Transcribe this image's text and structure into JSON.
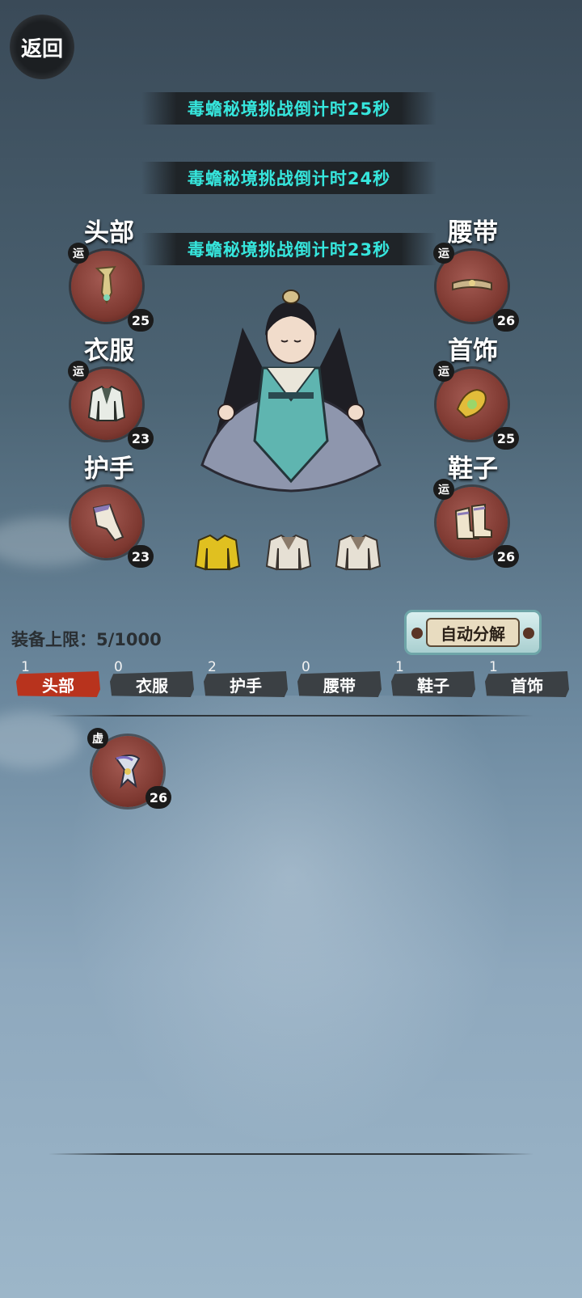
{
  "header": {
    "back_label": "返回"
  },
  "banners": [
    "毒蟾秘境挑战倒计时25秒",
    "毒蟾秘境挑战倒计时24秒",
    "毒蟾秘境挑战倒计时23秒"
  ],
  "slots": {
    "head": {
      "title": "头部",
      "badge": "运",
      "level": "25"
    },
    "clothes": {
      "title": "衣服",
      "badge": "运",
      "level": "23"
    },
    "hands": {
      "title": "护手",
      "badge": "",
      "level": "23"
    },
    "belt": {
      "title": "腰带",
      "badge": "运",
      "level": "26"
    },
    "accessory": {
      "title": "首饰",
      "badge": "运",
      "level": "25"
    },
    "shoes": {
      "title": "鞋子",
      "badge": "运",
      "level": "26"
    }
  },
  "inventory": {
    "capacity_label": "装备上限：5/1000",
    "auto_decompose_label": "自动分解",
    "tabs": [
      {
        "label": "头部",
        "count": "1",
        "active": true
      },
      {
        "label": "衣服",
        "count": "0"
      },
      {
        "label": "护手",
        "count": "2"
      },
      {
        "label": "腰带",
        "count": "0"
      },
      {
        "label": "鞋子",
        "count": "1"
      },
      {
        "label": "首饰",
        "count": "1"
      }
    ],
    "items": [
      {
        "badge": "虚",
        "level": "26",
        "icon": "headpiece-icon"
      }
    ]
  },
  "colors": {
    "banner_text": "#36e6dd",
    "active_tab": "#b8331d",
    "slot_bg": "#7d3830"
  }
}
